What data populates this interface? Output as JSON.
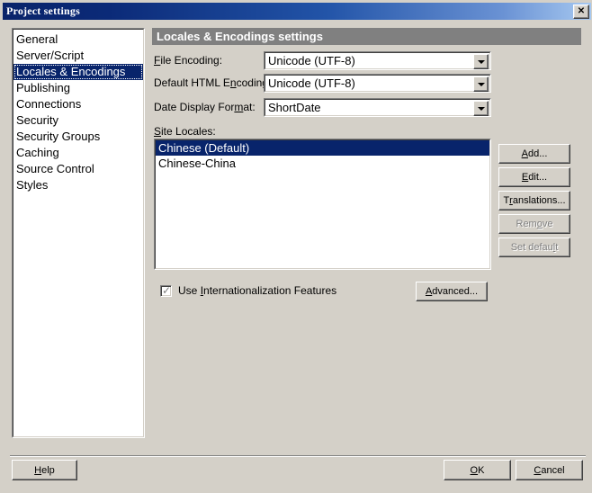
{
  "window": {
    "title": "Project settings",
    "close_label": "✕",
    "close_icon": "close-icon"
  },
  "sidebar": {
    "items": [
      {
        "label": "General",
        "selected": false
      },
      {
        "label": "Server/Script",
        "selected": false
      },
      {
        "label": "Locales & Encodings",
        "selected": true
      },
      {
        "label": "Publishing",
        "selected": false
      },
      {
        "label": "Connections",
        "selected": false
      },
      {
        "label": "Security",
        "selected": false
      },
      {
        "label": "Security Groups",
        "selected": false
      },
      {
        "label": "Caching",
        "selected": false
      },
      {
        "label": "Source Control",
        "selected": false
      },
      {
        "label": "Styles",
        "selected": false
      }
    ]
  },
  "panel": {
    "header": "Locales & Encodings settings",
    "fields": [
      {
        "label_pre": "",
        "label_accel": "F",
        "label_post": "ile Encoding:",
        "value": "Unicode (UTF-8)",
        "name": "file-encoding"
      },
      {
        "label_pre": "Default HTML E",
        "label_accel": "n",
        "label_post": "coding:",
        "value": "Unicode (UTF-8)",
        "name": "default-html-encoding"
      },
      {
        "label_pre": "Date Display For",
        "label_accel": "m",
        "label_post": "at:",
        "value": "ShortDate",
        "name": "date-display-format"
      }
    ],
    "locales_label_pre": "",
    "locales_label_accel": "S",
    "locales_label_post": "ite Locales:",
    "locales": [
      {
        "label": "Chinese (Default)",
        "selected": true
      },
      {
        "label": "Chinese-China",
        "selected": false
      }
    ],
    "side_buttons": [
      {
        "pre": "",
        "accel": "A",
        "post": "dd...",
        "disabled": false,
        "name": "add-button"
      },
      {
        "pre": "",
        "accel": "E",
        "post": "dit...",
        "disabled": false,
        "name": "edit-button"
      },
      {
        "pre": "T",
        "accel": "r",
        "post": "anslations...",
        "disabled": false,
        "name": "translations-button"
      },
      {
        "pre": "Rem",
        "accel": "o",
        "post": "ve",
        "disabled": true,
        "name": "remove-button"
      },
      {
        "pre": "Set defau",
        "accel": "l",
        "post": "t",
        "disabled": true,
        "name": "set-default-button"
      }
    ],
    "intl_checkbox": {
      "checked": true,
      "glyph": "✓",
      "label_pre": "Use ",
      "label_accel": "I",
      "label_post": "nternationalization Features"
    },
    "advanced_button": {
      "pre": "",
      "accel": "A",
      "post": "dvanced..."
    }
  },
  "footer": {
    "help": {
      "pre": "",
      "accel": "H",
      "post": "elp"
    },
    "ok": {
      "pre": "",
      "accel": "O",
      "post": "K"
    },
    "cancel": {
      "pre": "",
      "accel": "C",
      "post": "ancel"
    }
  },
  "colors": {
    "face": "#d4d0c8",
    "selection": "#08246b",
    "header_bar": "#808080",
    "title_start": "#0a246a",
    "title_end": "#a6c8f0",
    "disabled_text": "#808080"
  }
}
